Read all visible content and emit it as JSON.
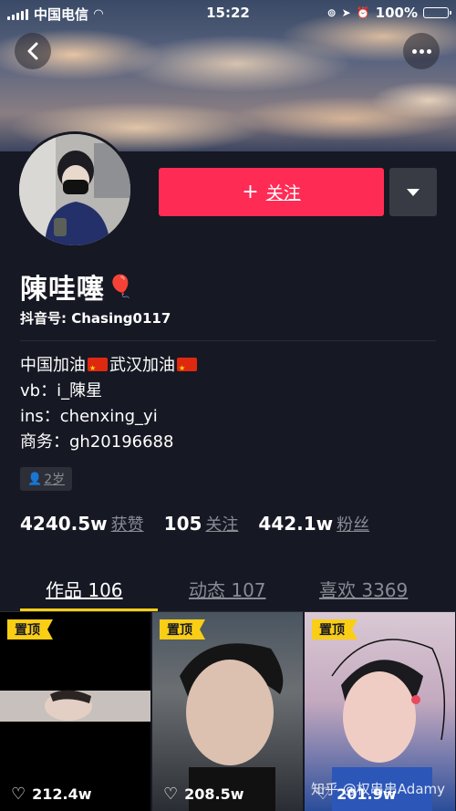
{
  "status_bar": {
    "carrier": "中国电信",
    "time": "15:22",
    "battery_text": "100%"
  },
  "profile": {
    "name": "陳哇噻",
    "douyin_id_label": "抖音号:",
    "douyin_id": "Chasing0117",
    "follow_label": "关注",
    "bio": [
      "中国加油",
      "武汉加油",
      "vb：i_陳星",
      "ins：chenxing_yi",
      "商务：gh20196688"
    ],
    "age_tag": "2岁"
  },
  "stats": {
    "likes_num": "4240.5w",
    "likes_label": "获赞",
    "following_num": "105",
    "following_label": "关注",
    "followers_num": "442.1w",
    "followers_label": "粉丝"
  },
  "tabs": [
    {
      "label": "作品 106",
      "active": true
    },
    {
      "label": "动态 107",
      "active": false
    },
    {
      "label": "喜欢 3369",
      "active": false
    }
  ],
  "videos": [
    {
      "pin": "置顶",
      "likes": "212.4w"
    },
    {
      "pin": "置顶",
      "likes": "208.5w"
    },
    {
      "pin": "置顶",
      "likes": "201.9w"
    }
  ],
  "watermark": "知乎 @权串串Adamy",
  "colors": {
    "background": "#161823",
    "follow_button": "#fe2c55",
    "tab_indicator": "#face15",
    "pin_badge": "#face15"
  }
}
